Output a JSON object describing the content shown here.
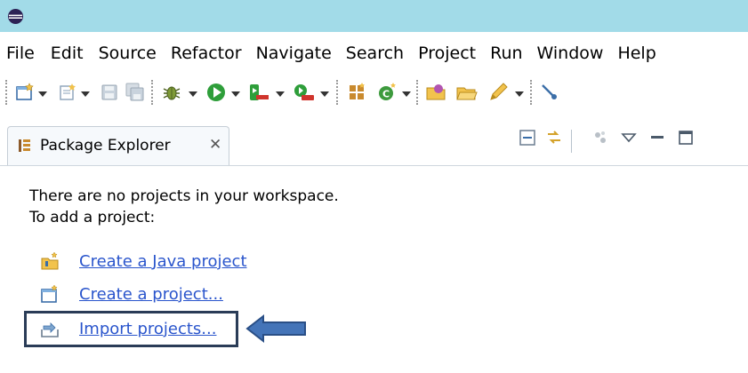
{
  "colors": {
    "title_bar": "#a2dbe8",
    "link": "#2a55cc",
    "highlight_border": "#2a3c57",
    "arrow_fill": "#4474b8"
  },
  "menu": {
    "items": [
      "File",
      "Edit",
      "Source",
      "Refactor",
      "Navigate",
      "Search",
      "Project",
      "Run",
      "Window",
      "Help"
    ]
  },
  "toolbar_icons": [
    "new-wizard-icon",
    "new-java-file-icon",
    "save-icon",
    "save-all-icon",
    "debug-icon",
    "run-icon",
    "coverage-icon",
    "external-tools-icon",
    "new-java-package-icon",
    "new-java-class-icon",
    "open-type-icon",
    "open-project-icon",
    "edit-icon",
    "toggle-breadcrumb-icon"
  ],
  "view": {
    "tab_label": "Package Explorer",
    "tab_close": "✕",
    "view_tool_icons": [
      "collapse-all-icon",
      "link-with-editor-icon",
      "focus-icon",
      "view-menu-icon",
      "minimize-icon",
      "maximize-icon"
    ]
  },
  "content": {
    "empty_message_line1": "There are no projects in your workspace.",
    "empty_message_line2": "To add a project:",
    "links": [
      {
        "label": "Create a Java project",
        "icon": "new-java-project-icon"
      },
      {
        "label": "Create a project...",
        "icon": "new-project-icon"
      },
      {
        "label": "Import projects...",
        "icon": "import-projects-icon"
      }
    ]
  },
  "annotation": {
    "highlighted_link": "Import projects...",
    "arrow_direction": "left"
  }
}
